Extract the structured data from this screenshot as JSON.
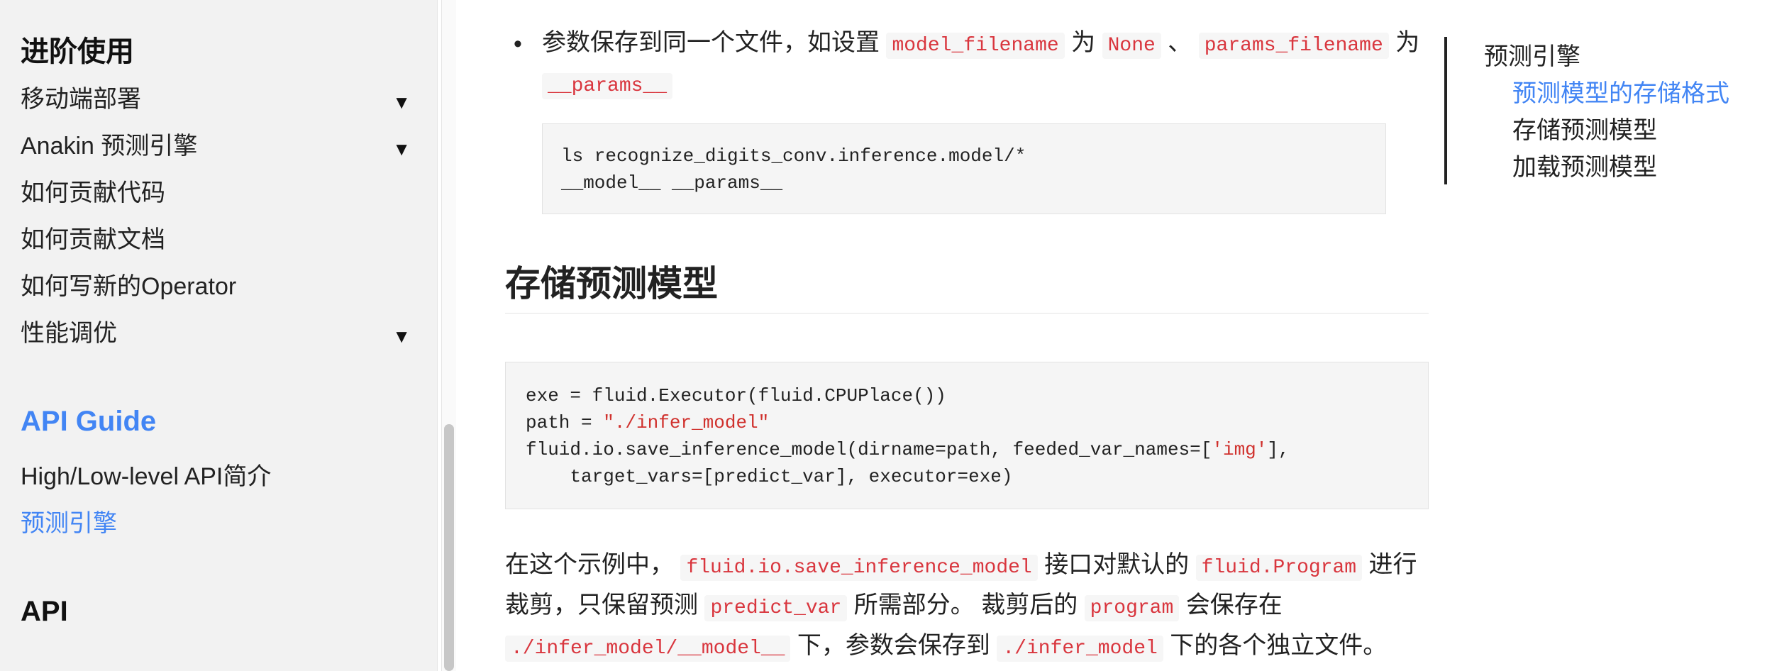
{
  "sidebar": {
    "section_advanced": "进阶使用",
    "items": [
      {
        "label": "移动端部署",
        "chevron": "▼"
      },
      {
        "label": "Anakin 预测引擎",
        "chevron": "▼"
      },
      {
        "label": "如何贡献代码"
      },
      {
        "label": "如何贡献文档"
      },
      {
        "label": "如何写新的Operator"
      },
      {
        "label": "性能调优",
        "chevron": "▼"
      }
    ],
    "section_api_guide": "API Guide",
    "api_guide_items": [
      {
        "label": "High/Low-level API简介"
      },
      {
        "label": "预测引擎"
      }
    ],
    "section_api": "API",
    "accent_color": "#4285f4"
  },
  "content": {
    "bullet1": {
      "text_a": "参数保存到同一个文件，如设置",
      "code_a": "model_filename",
      "text_b": "为",
      "code_b": "None",
      "text_c": "、",
      "code_c": "params_filename",
      "text_d": "为",
      "code_d": "__params__"
    },
    "codeblock1": {
      "line1": "ls recognize_digits_conv.inference.model/*",
      "line2": "__model__ __params__"
    },
    "heading": "存储预测模型",
    "codeblock2": {
      "line1": "exe = fluid.Executor(fluid.CPUPlace())",
      "line2_pre": "path = ",
      "line2_str": "\"./infer_model\"",
      "line3_pre": "fluid.io.save_inference_model(dirname=path, feeded_var_names=[",
      "line3_str": "'img'",
      "line3_post": "],",
      "line4": "    target_vars=[predict_var], executor=exe)"
    },
    "paragraph": {
      "t1": "在这个示例中，",
      "c1": "fluid.io.save_inference_model",
      "t2": "接口对默认的",
      "c2": "fluid.Program",
      "t3": "进行",
      "t4": "裁剪，只保留预测",
      "c3": "predict_var",
      "t5": "所需部分。 裁剪后的",
      "c4": "program",
      "t6": "会保存在",
      "c5": "./infer_model/__model__",
      "t7": "下，参数会保存到",
      "c6": "./infer_model",
      "t8": "下的各个独立文件。"
    }
  },
  "toc": {
    "items": [
      {
        "label": "预测引擎"
      },
      {
        "label": "预测模型的存储格式",
        "active": true
      },
      {
        "label": "存储预测模型"
      },
      {
        "label": "加载预测模型"
      }
    ]
  }
}
